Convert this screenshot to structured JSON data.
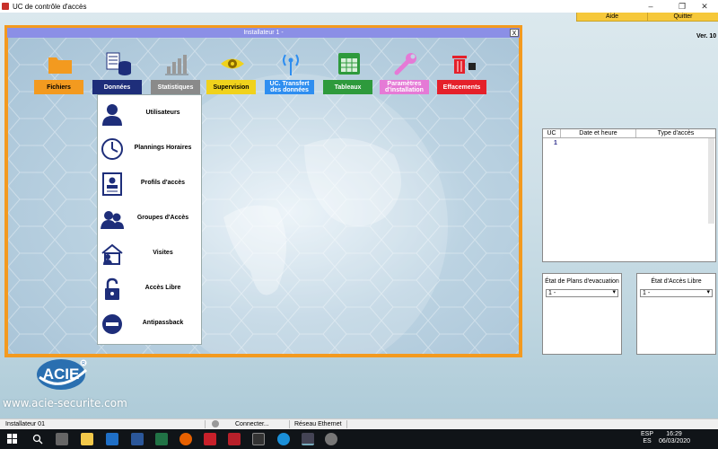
{
  "window": {
    "title": "UC de contrôle d'accès",
    "minimize": "–",
    "maximize": "❐",
    "close": "✕"
  },
  "menu": {
    "help": "Aide",
    "quit": "Quitter"
  },
  "version": "Ver. 10",
  "installer": {
    "title": "Installateur 1 -",
    "close": "X",
    "modules": [
      {
        "label": "Fichiers",
        "color": "#f39a1f",
        "icon": "folder-icon"
      },
      {
        "label": "Données",
        "color": "#1e2e7a",
        "icon": "database-icon"
      },
      {
        "label": "Statistiques",
        "color": "#8a8a8a",
        "icon": "bar-chart-icon"
      },
      {
        "label": "Supervision",
        "color": "#f0d21c",
        "icon": "eye-icon"
      },
      {
        "label": "UC. Transfert des données",
        "color": "#2e8ef0",
        "icon": "antenna-icon"
      },
      {
        "label": "Tableaux",
        "color": "#2e9a3c",
        "icon": "spreadsheet-icon"
      },
      {
        "label": "Paramètres d'installation",
        "color": "#e57ad6",
        "icon": "wrench-icon"
      },
      {
        "label": "Effacements",
        "color": "#e5202a",
        "icon": "trash-icon"
      }
    ],
    "dropdown": [
      {
        "label": "Utilisateurs",
        "icon": "user-icon"
      },
      {
        "label": "Plannings Horaires",
        "icon": "clock-icon"
      },
      {
        "label": "Profils d'accès",
        "icon": "profile-card-icon"
      },
      {
        "label": "Groupes d'Accès",
        "icon": "group-icon"
      },
      {
        "label": "Visites",
        "icon": "house-visitor-icon"
      },
      {
        "label": "Accès Libre",
        "icon": "unlock-icon"
      },
      {
        "label": "Antipassback",
        "icon": "no-entry-icon"
      }
    ]
  },
  "uc_table": {
    "columns": [
      "UC",
      "Date et heure",
      "Type d'accès"
    ],
    "rows": [
      [
        "1",
        "",
        ""
      ]
    ]
  },
  "evacuation": {
    "label": "État de Plans d'evacuation",
    "value": "1 -"
  },
  "free_access": {
    "label": "État d'Accès Libre",
    "value": "1 -"
  },
  "brand": {
    "logo": "ACIE",
    "website": "www.acie-securite.com"
  },
  "status": {
    "user": "Installateur 01",
    "connection": "Connecter...",
    "network": "Réseau Ethernet"
  },
  "taskbar": {
    "lang1": "ESP",
    "lang2": "ES",
    "time": "16:29",
    "date": "06/03/2020"
  }
}
